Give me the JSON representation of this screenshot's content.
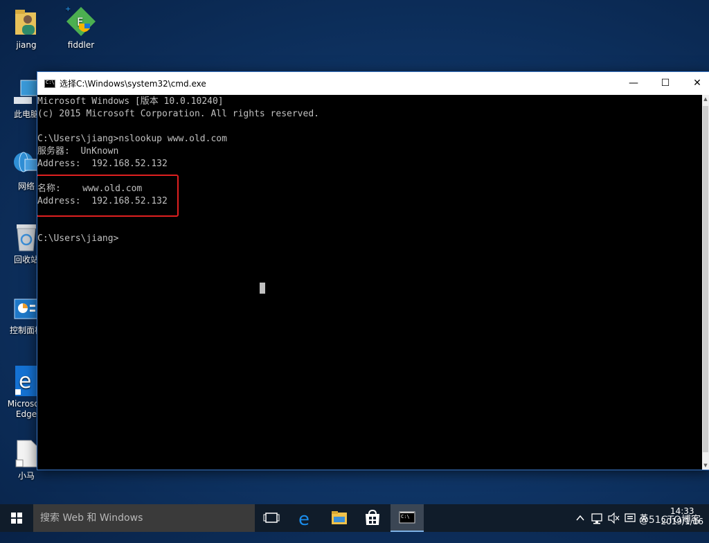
{
  "desktop": {
    "icons": [
      {
        "label": "jiang"
      },
      {
        "label": "fiddler"
      },
      {
        "label": "此电脑"
      },
      {
        "label": "网络"
      },
      {
        "label": "回收站"
      },
      {
        "label": "控制面板"
      },
      {
        "label": "Microsoft Edge"
      },
      {
        "label": "小马"
      }
    ]
  },
  "window": {
    "title": "选择C:\\Windows\\system32\\cmd.exe",
    "minimize": "—",
    "maximize": "☐",
    "close": "✕"
  },
  "console": {
    "lines": [
      "Microsoft Windows [版本 10.0.10240]",
      "(c) 2015 Microsoft Corporation. All rights reserved.",
      "",
      "C:\\Users\\jiang>nslookup www.old.com",
      "服务器:  UnKnown",
      "Address:  192.168.52.132",
      "",
      "名称:    www.old.com",
      "Address:  192.168.52.132",
      "",
      "",
      "C:\\Users\\jiang>"
    ]
  },
  "taskbar": {
    "search_placeholder": "搜索 Web 和 Windows",
    "tray_input": "英",
    "clock_time": "14:33",
    "clock_date": "2019/1/16",
    "watermark": "@51CTO博客"
  },
  "colors": {
    "console_bg": "#000000",
    "console_fg": "#c0c0c0",
    "highlight_box": "#e02020",
    "taskbar_bg": "#101c2a"
  }
}
